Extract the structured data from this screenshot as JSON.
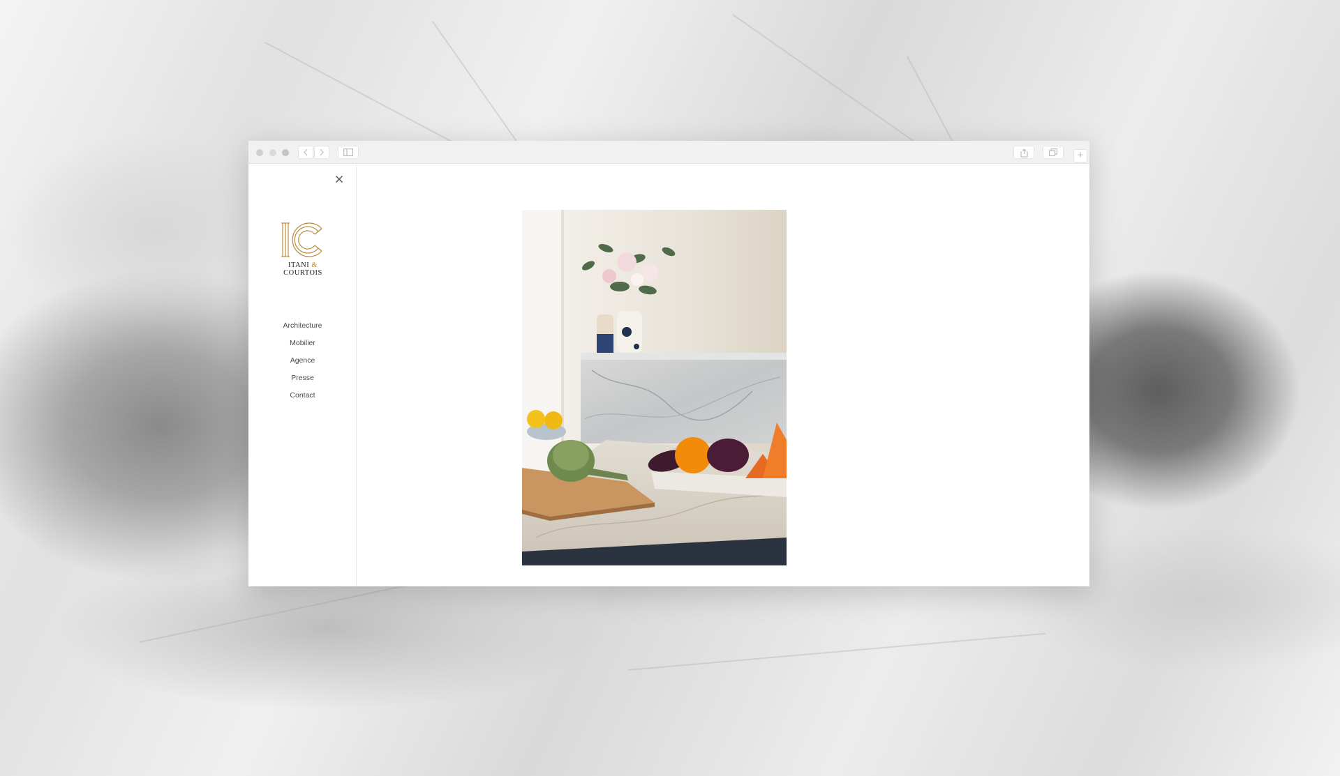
{
  "browser": {
    "window_buttons": [
      "close",
      "minimize",
      "zoom"
    ],
    "nav_icons": [
      "back-arrow-icon",
      "forward-arrow-icon",
      "sidebar-icon"
    ],
    "action_icons": [
      "share-icon",
      "tabs-icon",
      "new-tab-icon"
    ],
    "new_tab_glyph": "+"
  },
  "site": {
    "logo": {
      "monogram": "IC",
      "line1": "ITANI",
      "ampersand": "&",
      "line2": "COURTOIS",
      "accent_color": "#b88a3e"
    },
    "close_icon": "close-icon",
    "nav": [
      {
        "label": "Architecture"
      },
      {
        "label": "Mobilier"
      },
      {
        "label": "Agence"
      },
      {
        "label": "Presse"
      },
      {
        "label": "Contact"
      }
    ]
  },
  "colors": {
    "page_bg": "#ffffff",
    "toolbar_bg": "#f1f1f1",
    "nav_text": "#4a4a4a",
    "logo_gold": "#b88a3e"
  }
}
